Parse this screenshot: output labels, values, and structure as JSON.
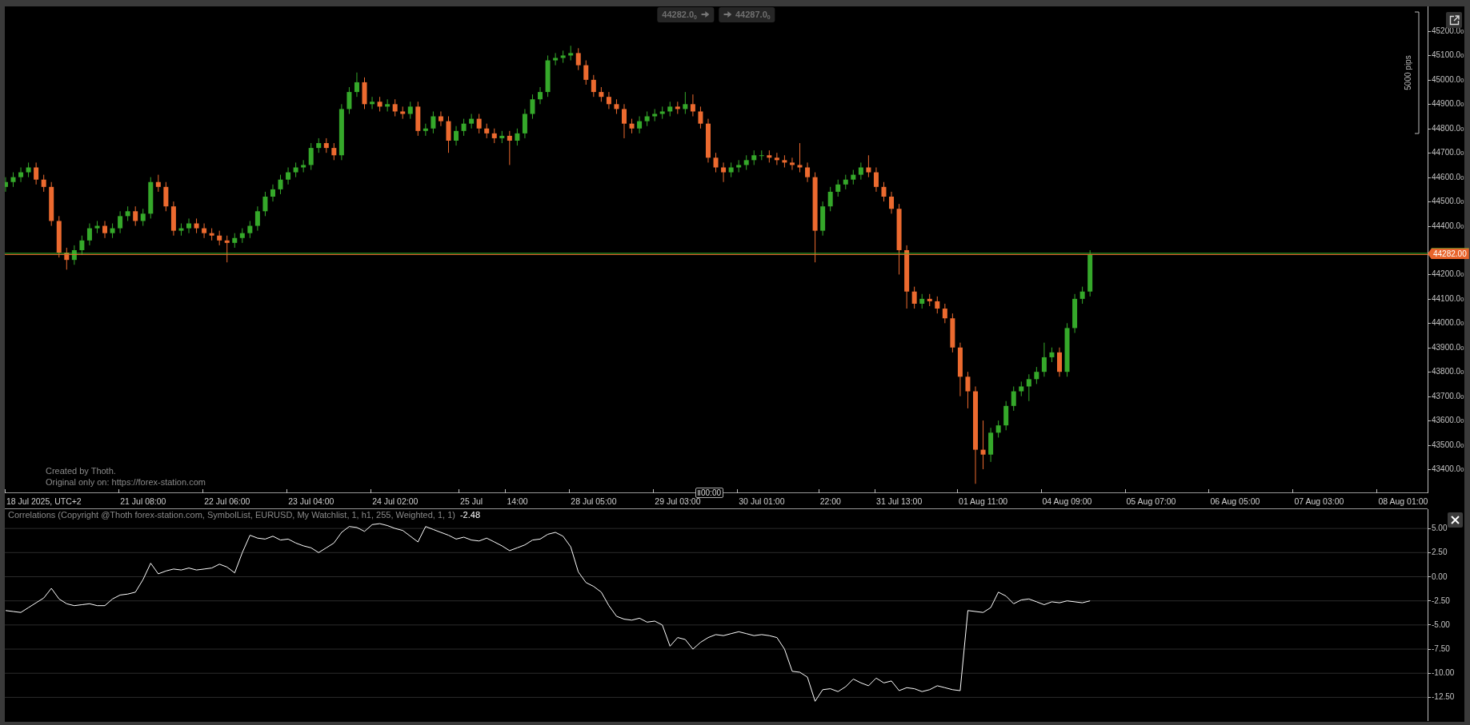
{
  "top_price_tags": [
    {
      "kind": "bid",
      "text": "44282.0$_{0}$"
    },
    {
      "kind": "ask",
      "text": "44287.0$_{0}$"
    }
  ],
  "price_chart": {
    "chart_data": {
      "type": "candlestick",
      "ylim": [
        43301.4,
        45301.8
      ],
      "categories": [
        null,
        null,
        null,
        null,
        null,
        "18 Jul 2025, UTC+2",
        null,
        null,
        null,
        null,
        null,
        null,
        null,
        null,
        null,
        null,
        null,
        null,
        "21 Jul 08:00",
        null,
        null,
        null,
        null,
        null,
        null,
        null,
        null,
        null,
        null,
        "22 Jul 06:00",
        null,
        null,
        null,
        null,
        null,
        null,
        null,
        null,
        null,
        null,
        "23 Jul 04:00",
        null,
        null,
        null,
        null,
        null,
        null,
        null,
        null,
        null,
        null,
        "24 Jul 02:00",
        null,
        null,
        null,
        null,
        null,
        null,
        null,
        null,
        null,
        "25 Jul",
        null,
        null,
        null,
        null,
        null,
        "14:00",
        null,
        null,
        null,
        null,
        null,
        null,
        null,
        null,
        null,
        "28 Jul 05:00",
        null,
        null,
        null,
        null,
        null,
        null,
        null,
        null,
        null,
        null,
        "29 Jul 03:00",
        null,
        null,
        null,
        null,
        null,
        null,
        null,
        null,
        null,
        null,
        "30 Jul 01:00",
        null,
        null,
        null,
        null,
        null,
        null,
        null,
        null,
        "22:00",
        null,
        null,
        null,
        null,
        null,
        null,
        null,
        null,
        "31 Jul 13:00",
        null,
        null,
        null,
        null,
        null,
        null,
        null,
        null,
        null,
        null,
        "01 Aug 11:00",
        null,
        null,
        null,
        null,
        null,
        null,
        null,
        null,
        null,
        null,
        "04 Aug 09:00",
        null,
        null,
        null,
        null,
        null,
        null,
        null,
        null,
        null,
        null,
        "05 Aug 07:00",
        null,
        null,
        null,
        null,
        null,
        null,
        null,
        null,
        null,
        null,
        "06 Aug 05:00",
        null,
        null,
        null,
        null,
        null,
        null,
        null,
        null,
        null,
        null,
        "07 Aug 03:00",
        null,
        null,
        null,
        null,
        null,
        null,
        null,
        null,
        null,
        null,
        "08 Aug 01:00",
        null,
        null,
        null
      ],
      "ohlc": [
        [
          44560,
          44600,
          44540,
          44580
        ],
        [
          44580,
          44620,
          44560,
          44600
        ],
        [
          44600,
          44640,
          44580,
          44620
        ],
        [
          44620,
          44660,
          44600,
          44640
        ],
        [
          44640,
          44660,
          44570,
          44590
        ],
        [
          44590,
          44610,
          44540,
          44560
        ],
        [
          44560,
          44580,
          44400,
          44420
        ],
        [
          44420,
          44440,
          44270,
          44290
        ],
        [
          44290,
          44310,
          44220,
          44260
        ],
        [
          44260,
          44320,
          44240,
          44300
        ],
        [
          44300,
          44360,
          44280,
          44340
        ],
        [
          44340,
          44410,
          44320,
          44390
        ],
        [
          44390,
          44420,
          44370,
          44400
        ],
        [
          44400,
          44420,
          44350,
          44370
        ],
        [
          44370,
          44410,
          44350,
          44390
        ],
        [
          44390,
          44460,
          44370,
          44440
        ],
        [
          44440,
          44480,
          44420,
          44460
        ],
        [
          44460,
          44480,
          44400,
          44420
        ],
        [
          44420,
          44470,
          44400,
          44450
        ],
        [
          44450,
          44600,
          44430,
          44580
        ],
        [
          44580,
          44610,
          44540,
          44560
        ],
        [
          44560,
          44580,
          44460,
          44480
        ],
        [
          44480,
          44500,
          44360,
          44380
        ],
        [
          44380,
          44410,
          44360,
          44390
        ],
        [
          44390,
          44430,
          44370,
          44410
        ],
        [
          44410,
          44430,
          44370,
          44390
        ],
        [
          44390,
          44410,
          44350,
          44370
        ],
        [
          44370,
          44390,
          44340,
          44360
        ],
        [
          44360,
          44380,
          44320,
          44340
        ],
        [
          44340,
          44360,
          44250,
          44330
        ],
        [
          44330,
          44370,
          44310,
          44350
        ],
        [
          44350,
          44390,
          44330,
          44370
        ],
        [
          44370,
          44420,
          44350,
          44400
        ],
        [
          44400,
          44480,
          44380,
          44460
        ],
        [
          44460,
          44540,
          44440,
          44520
        ],
        [
          44520,
          44570,
          44500,
          44550
        ],
        [
          44550,
          44610,
          44530,
          44590
        ],
        [
          44590,
          44640,
          44570,
          44620
        ],
        [
          44620,
          44660,
          44600,
          44640
        ],
        [
          44640,
          44670,
          44620,
          44650
        ],
        [
          44650,
          44740,
          44630,
          44720
        ],
        [
          44720,
          44760,
          44700,
          44740
        ],
        [
          44740,
          44760,
          44700,
          44720
        ],
        [
          44720,
          44740,
          44670,
          44690
        ],
        [
          44690,
          44900,
          44670,
          44880
        ],
        [
          44880,
          44970,
          44860,
          44950
        ],
        [
          44950,
          45030,
          44930,
          44990
        ],
        [
          44990,
          45010,
          44880,
          44900
        ],
        [
          44900,
          44930,
          44880,
          44910
        ],
        [
          44910,
          44930,
          44870,
          44890
        ],
        [
          44890,
          44920,
          44870,
          44900
        ],
        [
          44900,
          44920,
          44850,
          44870
        ],
        [
          44870,
          44890,
          44840,
          44860
        ],
        [
          44860,
          44910,
          44840,
          44890
        ],
        [
          44890,
          44910,
          44770,
          44790
        ],
        [
          44790,
          44820,
          44770,
          44800
        ],
        [
          44800,
          44870,
          44780,
          44850
        ],
        [
          44850,
          44870,
          44810,
          44830
        ],
        [
          44830,
          44850,
          44700,
          44750
        ],
        [
          44750,
          44810,
          44730,
          44790
        ],
        [
          44790,
          44840,
          44770,
          44820
        ],
        [
          44820,
          44860,
          44800,
          44840
        ],
        [
          44840,
          44860,
          44780,
          44800
        ],
        [
          44800,
          44820,
          44760,
          44780
        ],
        [
          44780,
          44800,
          44740,
          44760
        ],
        [
          44760,
          44790,
          44740,
          44770
        ],
        [
          44770,
          44790,
          44650,
          44750
        ],
        [
          44750,
          44800,
          44730,
          44780
        ],
        [
          44780,
          44880,
          44760,
          44860
        ],
        [
          44860,
          44940,
          44840,
          44920
        ],
        [
          44920,
          44970,
          44900,
          44950
        ],
        [
          44950,
          45100,
          44930,
          45080
        ],
        [
          45080,
          45110,
          45060,
          45090
        ],
        [
          45090,
          45120,
          45070,
          45100
        ],
        [
          45100,
          45140,
          45080,
          45110
        ],
        [
          45110,
          45130,
          45040,
          45060
        ],
        [
          45060,
          45080,
          44980,
          45000
        ],
        [
          45000,
          45020,
          44930,
          44950
        ],
        [
          44950,
          44970,
          44910,
          44930
        ],
        [
          44930,
          44950,
          44880,
          44900
        ],
        [
          44900,
          44920,
          44860,
          44880
        ],
        [
          44880,
          44900,
          44760,
          44820
        ],
        [
          44820,
          44840,
          44780,
          44800
        ],
        [
          44800,
          44850,
          44780,
          44830
        ],
        [
          44830,
          44870,
          44810,
          44850
        ],
        [
          44850,
          44880,
          44830,
          44860
        ],
        [
          44860,
          44890,
          44840,
          44870
        ],
        [
          44870,
          44910,
          44850,
          44890
        ],
        [
          44890,
          44910,
          44860,
          44880
        ],
        [
          44880,
          44950,
          44860,
          44900
        ],
        [
          44900,
          44940,
          44850,
          44870
        ],
        [
          44870,
          44890,
          44800,
          44820
        ],
        [
          44820,
          44840,
          44660,
          44680
        ],
        [
          44680,
          44700,
          44620,
          44640
        ],
        [
          44640,
          44660,
          44580,
          44620
        ],
        [
          44620,
          44660,
          44600,
          44640
        ],
        [
          44640,
          44670,
          44620,
          44650
        ],
        [
          44650,
          44690,
          44630,
          44670
        ],
        [
          44670,
          44710,
          44650,
          44690
        ],
        [
          44690,
          44710,
          44670,
          44690
        ],
        [
          44690,
          44710,
          44660,
          44680
        ],
        [
          44680,
          44700,
          44650,
          44670
        ],
        [
          44670,
          44690,
          44640,
          44660
        ],
        [
          44660,
          44680,
          44630,
          44650
        ],
        [
          44650,
          44740,
          44620,
          44640
        ],
        [
          44640,
          44660,
          44580,
          44600
        ],
        [
          44600,
          44620,
          44250,
          44380
        ],
        [
          44380,
          44500,
          44360,
          44480
        ],
        [
          44480,
          44560,
          44460,
          44540
        ],
        [
          44540,
          44590,
          44520,
          44570
        ],
        [
          44570,
          44610,
          44550,
          44590
        ],
        [
          44590,
          44630,
          44570,
          44610
        ],
        [
          44610,
          44660,
          44590,
          44640
        ],
        [
          44640,
          44690,
          44600,
          44620
        ],
        [
          44620,
          44640,
          44540,
          44560
        ],
        [
          44560,
          44580,
          44500,
          44520
        ],
        [
          44520,
          44540,
          44450,
          44470
        ],
        [
          44470,
          44490,
          44200,
          44300
        ],
        [
          44300,
          44320,
          44060,
          44130
        ],
        [
          44130,
          44150,
          44060,
          44080
        ],
        [
          44080,
          44120,
          44060,
          44100
        ],
        [
          44100,
          44120,
          44070,
          44090
        ],
        [
          44090,
          44110,
          44040,
          44060
        ],
        [
          44060,
          44080,
          44000,
          44020
        ],
        [
          44020,
          44040,
          43880,
          43900
        ],
        [
          43900,
          43920,
          43700,
          43780
        ],
        [
          43780,
          43800,
          43650,
          43720
        ],
        [
          43720,
          43740,
          43340,
          43480
        ],
        [
          43480,
          43600,
          43400,
          43460
        ],
        [
          43460,
          43570,
          43430,
          43550
        ],
        [
          43550,
          43600,
          43530,
          43580
        ],
        [
          43580,
          43680,
          43560,
          43660
        ],
        [
          43660,
          43740,
          43640,
          43720
        ],
        [
          43720,
          43760,
          43700,
          43740
        ],
        [
          43740,
          43790,
          43680,
          43770
        ],
        [
          43770,
          43820,
          43750,
          43800
        ],
        [
          43800,
          43920,
          43780,
          43860
        ],
        [
          43860,
          43900,
          43840,
          43880
        ],
        [
          43880,
          43900,
          43780,
          43800
        ],
        [
          43800,
          44000,
          43780,
          43980
        ],
        [
          43980,
          44120,
          43960,
          44100
        ],
        [
          44100,
          44150,
          44080,
          44130
        ],
        [
          44130,
          44300,
          44110,
          44282
        ],
        null,
        null,
        null,
        null,
        null,
        null,
        null,
        null,
        null,
        null,
        null,
        null,
        null,
        null,
        null,
        null,
        null,
        null,
        null,
        null,
        null,
        null,
        null,
        null,
        null,
        null,
        null,
        null,
        null,
        null,
        null,
        null,
        null,
        null,
        null,
        null,
        null,
        null,
        null,
        null,
        null,
        null,
        null,
        null
      ],
      "yticks": [
        {
          "value": 45200,
          "label": "45200.00"
        },
        {
          "value": 45100,
          "label": "45100.00"
        },
        {
          "value": 45000,
          "label": "45000.00"
        },
        {
          "value": 44900,
          "label": "44900.00"
        },
        {
          "value": 44800,
          "label": "44800.00"
        },
        {
          "value": 44700,
          "label": "44700.00"
        },
        {
          "value": 44600,
          "label": "44600.00"
        },
        {
          "value": 44500,
          "label": "44500.00"
        },
        {
          "value": 44400,
          "label": "44400.00"
        },
        {
          "value": 44200,
          "label": "44200.00"
        },
        {
          "value": 44100,
          "label": "44100.00"
        },
        {
          "value": 44000,
          "label": "44000.00"
        },
        {
          "value": 43900,
          "label": "43900.00"
        },
        {
          "value": 43800,
          "label": "43800.00"
        },
        {
          "value": 43700,
          "label": "43700.00"
        },
        {
          "value": 43600,
          "label": "43600.00"
        },
        {
          "value": 43500,
          "label": "43500.00"
        },
        {
          "value": 43400,
          "label": "43400.00"
        }
      ],
      "ref_lines": [
        {
          "axis": "y",
          "value": 44287,
          "color": "#3fbf2f"
        },
        {
          "axis": "y",
          "value": 44282,
          "color": "#e8642b"
        }
      ]
    },
    "current_price": "44282.00",
    "range_ruler": "5000 pips",
    "bar_timer": "00:00",
    "credits": [
      "Created by Thoth.",
      "Original only on: https://forex-station.com"
    ]
  },
  "indicator": {
    "title": "Correlations (Copyright @Thoth forex-station.com, SymbolList, EURUSD, My Watchlist, 1, h1, 255, Weighted, 1, 1)",
    "value": "-2.48",
    "chart_data": {
      "type": "line",
      "grid": true,
      "ylim": [
        -14.95,
        7.0
      ],
      "series": [
        {
          "color": "#ffffff",
          "values": [
            -3.5,
            -3.6,
            -3.7,
            -3.2,
            -2.7,
            -2.2,
            -1.2,
            -2.3,
            -2.8,
            -3.0,
            -2.9,
            -2.8,
            -3.0,
            -3.0,
            -2.3,
            -1.9,
            -1.8,
            -1.6,
            -0.3,
            1.4,
            0.3,
            0.6,
            0.8,
            0.7,
            0.9,
            0.7,
            0.8,
            0.9,
            1.3,
            1.0,
            0.4,
            2.5,
            4.3,
            4.0,
            3.9,
            4.2,
            3.8,
            3.9,
            3.5,
            3.2,
            3.0,
            2.5,
            3.0,
            3.5,
            4.6,
            5.2,
            5.1,
            4.7,
            5.4,
            5.5,
            5.3,
            5.0,
            4.8,
            4.2,
            3.6,
            5.2,
            4.9,
            4.6,
            4.3,
            3.9,
            4.1,
            3.8,
            3.7,
            4.0,
            3.6,
            3.2,
            2.7,
            3.0,
            3.3,
            3.8,
            3.9,
            4.4,
            4.6,
            4.2,
            3.1,
            0.5,
            -0.6,
            -1.0,
            -1.6,
            -3.0,
            -4.1,
            -4.4,
            -4.5,
            -4.3,
            -4.7,
            -4.6,
            -5.0,
            -7.2,
            -6.3,
            -6.5,
            -7.5,
            -6.8,
            -6.3,
            -6.0,
            -6.1,
            -5.9,
            -5.7,
            -5.9,
            -6.1,
            -6.0,
            -6.1,
            -6.3,
            -7.5,
            -9.8,
            -9.9,
            -10.4,
            -12.9,
            -11.7,
            -11.6,
            -11.9,
            -11.4,
            -10.6,
            -11.0,
            -11.3,
            -10.5,
            -11.0,
            -10.8,
            -11.8,
            -11.5,
            -11.6,
            -11.9,
            -11.7,
            -11.3,
            -11.5,
            -11.7,
            -11.8,
            -3.5,
            -3.6,
            -3.7,
            -3.2,
            -1.6,
            -2.0,
            -2.8,
            -2.4,
            -2.3,
            -2.6,
            -2.9,
            -2.6,
            -2.7,
            -2.5,
            -2.6,
            -2.7,
            -2.5
          ]
        }
      ],
      "yticks": [
        {
          "value": 5,
          "label": "5.00"
        },
        {
          "value": 2.5,
          "label": "2.50"
        },
        {
          "value": 0,
          "label": "0.00"
        },
        {
          "value": -2.5,
          "label": "-2.50"
        },
        {
          "value": -5,
          "label": "-5.00"
        },
        {
          "value": -7.5,
          "label": "-7.50"
        },
        {
          "value": -10,
          "label": "-10.00"
        },
        {
          "value": -12.5,
          "label": "-12.50"
        }
      ]
    }
  }
}
